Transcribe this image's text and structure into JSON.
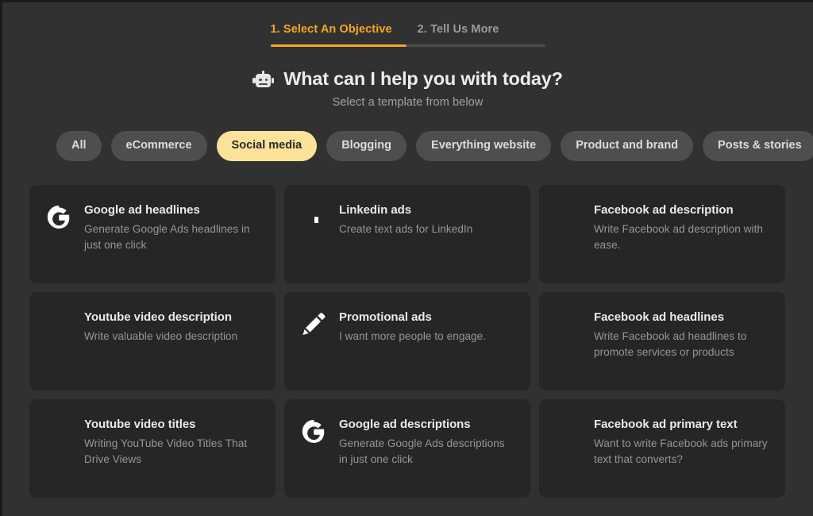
{
  "stepper": {
    "tabs": [
      {
        "label": "1. Select An Objective",
        "state": "active"
      },
      {
        "label": "2. Tell Us More",
        "state": "inactive"
      }
    ],
    "accent_color": "#f5a623",
    "track_color": "#4d4d4d"
  },
  "header": {
    "icon": "robot-icon",
    "title": "What can I help you with today?",
    "subtitle": "Select a template from below"
  },
  "filters": {
    "selected": "Social media",
    "selected_bg": "#fde39a",
    "chip_bg": "#4e4e4e",
    "chips": [
      "All",
      "eCommerce",
      "Social media",
      "Blogging",
      "Everything website",
      "Product and brand",
      "Posts & stories"
    ]
  },
  "templates": {
    "card_bg": "#262626",
    "items": [
      {
        "icon": "google-icon",
        "title": "Google ad headlines",
        "description": "Generate Google Ads headlines in just one click"
      },
      {
        "icon": "linkedin-icon",
        "title": "Linkedin ads",
        "description": "Create text ads for LinkedIn"
      },
      {
        "icon": "facebook-icon",
        "title": "Facebook ad description",
        "description": "Write Facebook ad description with ease."
      },
      {
        "icon": "youtube-icon",
        "title": "Youtube video description",
        "description": "Write valuable video description"
      },
      {
        "icon": "pencil-icon",
        "title": "Promotional ads",
        "description": "I want more people to engage."
      },
      {
        "icon": "facebook-icon",
        "title": "Facebook ad headlines",
        "description": "Write Facebook ad headlines to promote services or products"
      },
      {
        "icon": "youtube-icon",
        "title": "Youtube video titles",
        "description": "Writing YouTube Video Titles That Drive Views"
      },
      {
        "icon": "google-icon",
        "title": "Google ad descriptions",
        "description": "Generate Google Ads descriptions in just one click"
      },
      {
        "icon": "facebook-icon",
        "title": "Facebook ad primary text",
        "description": "Want to write Facebook ads primary text that converts?"
      }
    ]
  }
}
